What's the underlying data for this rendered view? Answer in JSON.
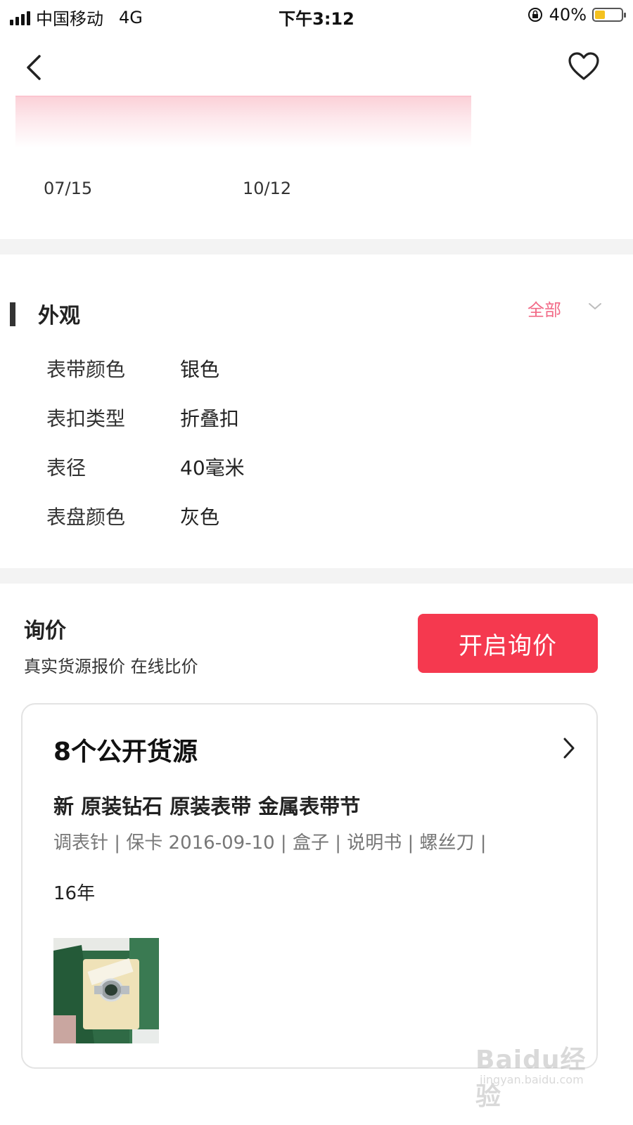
{
  "status_bar": {
    "carrier": "中国移动",
    "network": "4G",
    "time": "下午3:12",
    "battery_percent": "40%",
    "battery_level": 0.4,
    "battery_color": "#f4c11f"
  },
  "nav": {
    "back_icon": "chevron-left-icon",
    "favorite_icon": "heart-outline-icon"
  },
  "chart": {
    "x_labels": [
      "07/15",
      "10/12"
    ],
    "fill_color": "#fbd0d7"
  },
  "appearance": {
    "title": "外观",
    "all_label": "全部",
    "all_color": "#f26a87",
    "specs": [
      {
        "key": "表带颜色",
        "value": "银色"
      },
      {
        "key": "表扣类型",
        "value": "折叠扣"
      },
      {
        "key": "表径",
        "value": "40毫米"
      },
      {
        "key": "表盘颜色",
        "value": "灰色"
      }
    ]
  },
  "inquiry": {
    "title": "询价",
    "subtitle": "真实货源报价 在线比价",
    "button_label": "开启询价",
    "button_color": "#f5394f"
  },
  "sources_card": {
    "title": "8个公开货源",
    "condition_line": "新 原装钻石 原装表带 金属表带节",
    "accessories_line": "调表针 | 保卡 2016-09-10 | 盒子 | 说明书 | 螺丝刀 |",
    "year": "16年",
    "thumbnail_icon": "watch-in-box-photo"
  },
  "watermark": {
    "brand": "Baidu经验",
    "url": "jingyan.baidu.com"
  }
}
